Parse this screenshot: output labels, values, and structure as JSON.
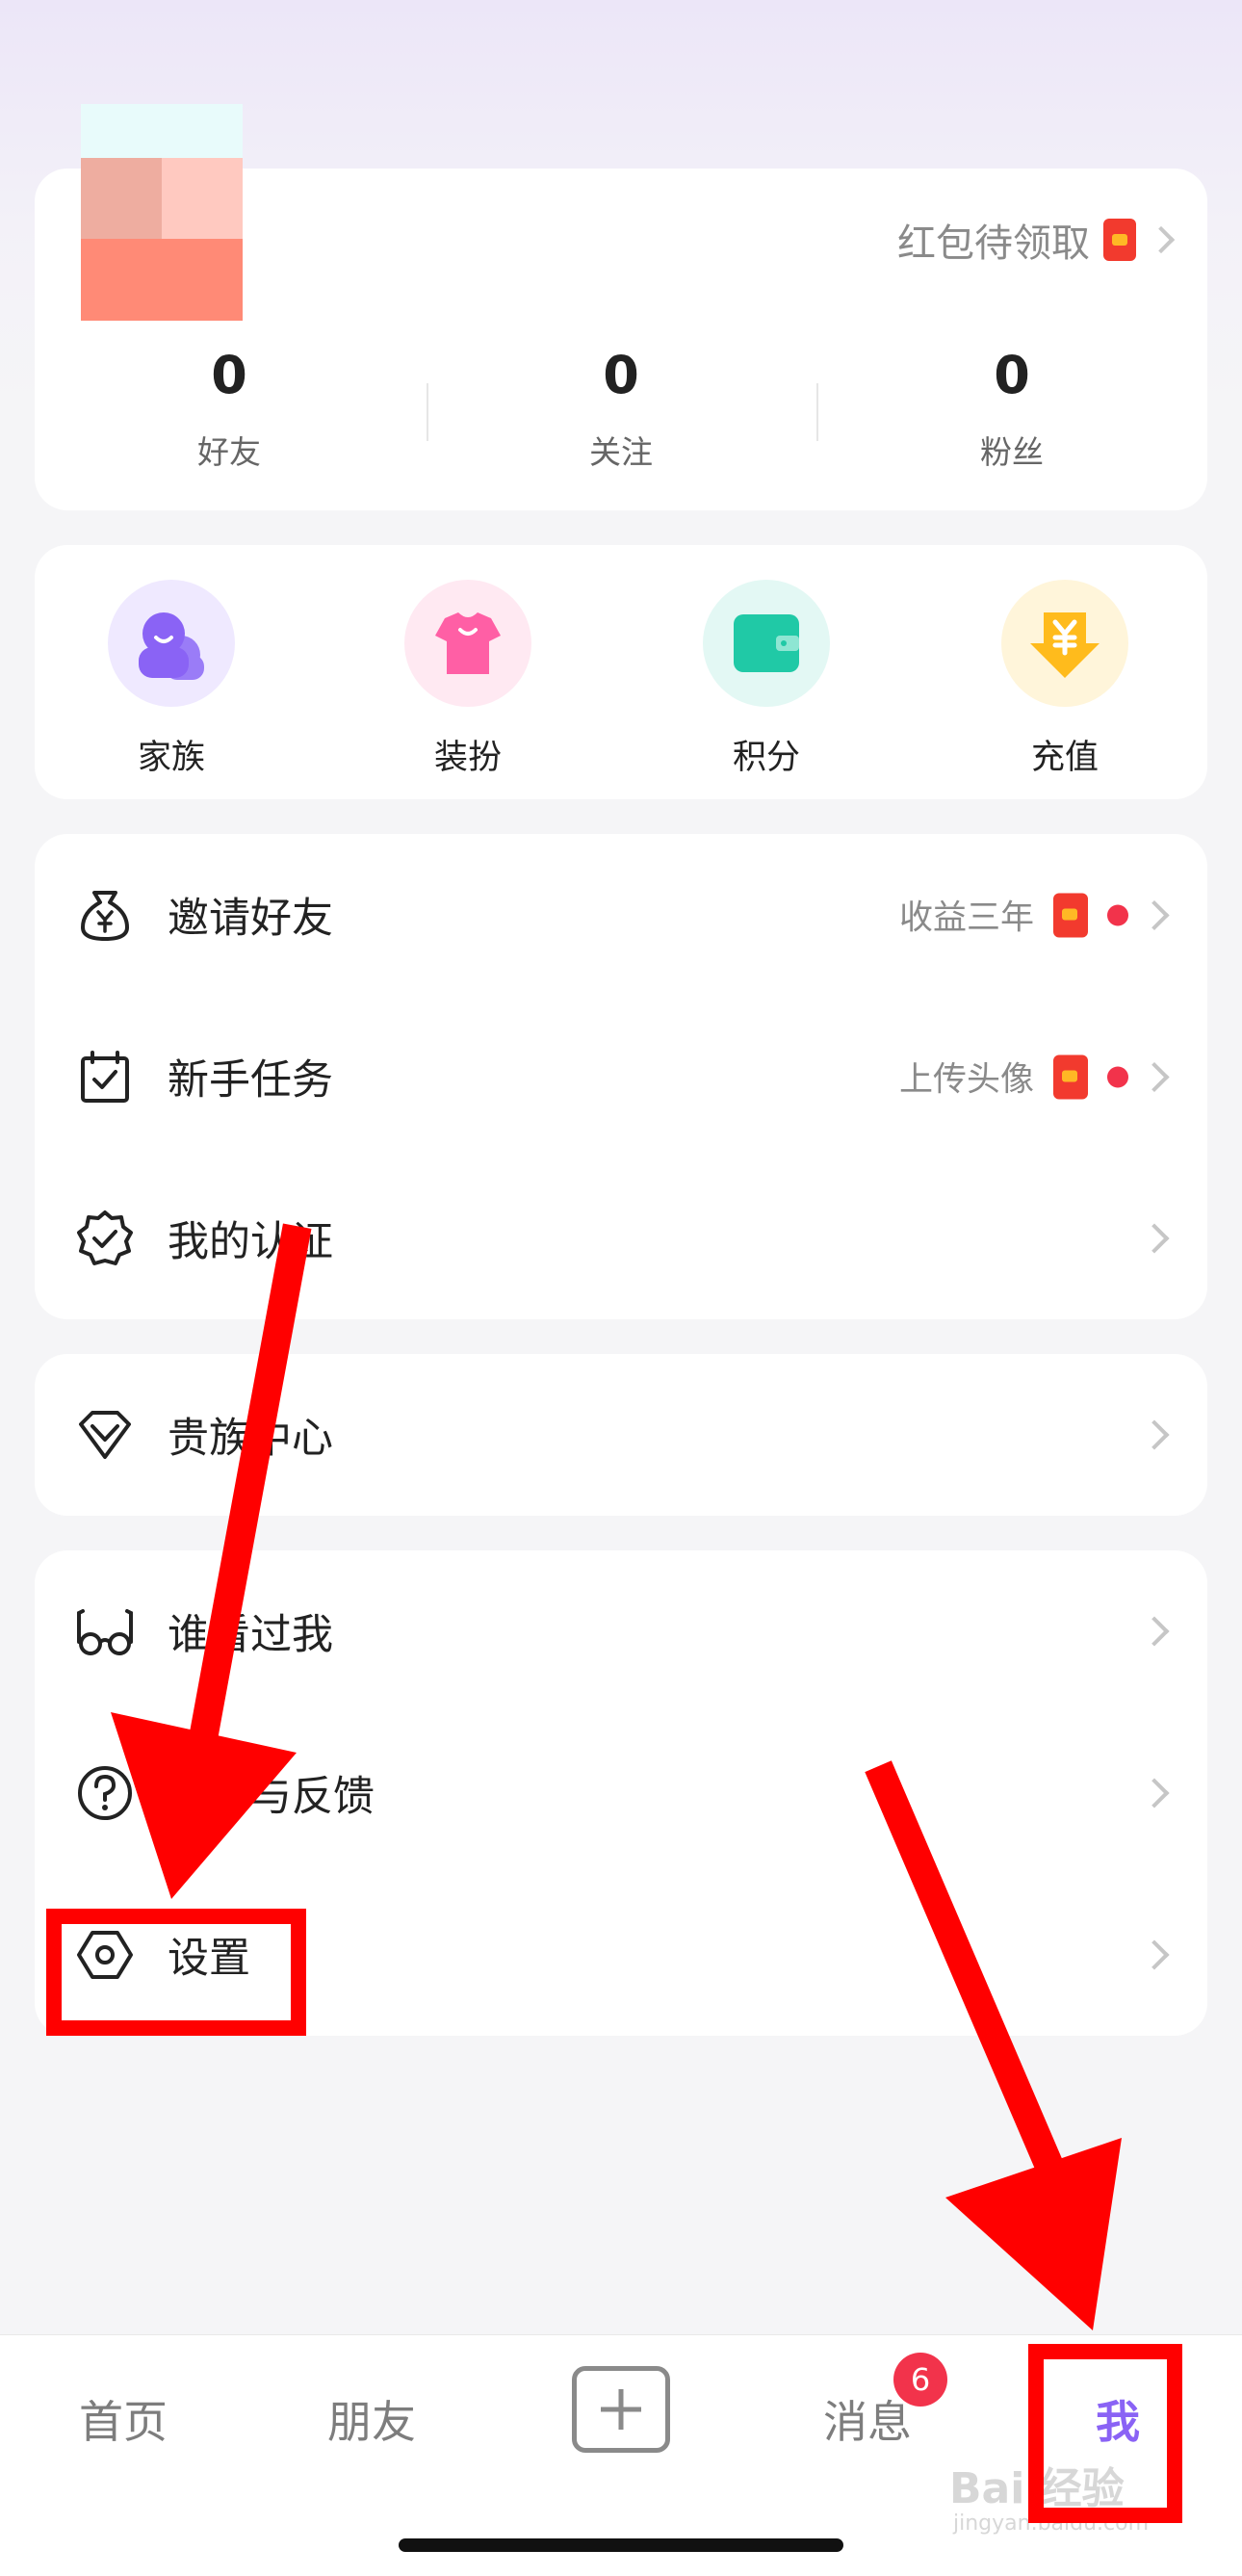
{
  "profile": {
    "redpacket_link": "红包待领取",
    "stats": [
      {
        "value": "0",
        "label": "好友"
      },
      {
        "value": "0",
        "label": "关注"
      },
      {
        "value": "0",
        "label": "粉丝"
      }
    ]
  },
  "quick_actions": [
    {
      "label": "家族",
      "icon": "family-icon"
    },
    {
      "label": "装扮",
      "icon": "tshirt-icon"
    },
    {
      "label": "积分",
      "icon": "wallet-icon"
    },
    {
      "label": "充值",
      "icon": "yuan-arrow-icon"
    }
  ],
  "menu_group_1": [
    {
      "label": "邀请好友",
      "note": "收益三年",
      "icon": "money-bag-icon",
      "has_redpacket": true,
      "has_dot": true
    },
    {
      "label": "新手任务",
      "note": "上传头像",
      "icon": "calendar-check-icon",
      "has_redpacket": true,
      "has_dot": true
    },
    {
      "label": "我的认证",
      "note": "",
      "icon": "verified-badge-icon"
    }
  ],
  "menu_group_2": [
    {
      "label": "贵族中心",
      "icon": "diamond-icon"
    }
  ],
  "menu_group_3": [
    {
      "label": "谁看过我",
      "icon": "glasses-icon"
    },
    {
      "label": "帮助与反馈",
      "icon": "question-icon"
    },
    {
      "label": "设置",
      "icon": "hexagon-settings-icon"
    }
  ],
  "bottom_nav": {
    "home": "首页",
    "friends": "朋友",
    "messages": "消息",
    "messages_badge": "6",
    "me": "我"
  },
  "watermark": {
    "title": "Bai 经验",
    "sub": "jingyan.baidu.com"
  },
  "colors": {
    "accent_purple": "#8a63f5",
    "badge_red": "#f2334b",
    "annotation_red": "#ff0000"
  }
}
